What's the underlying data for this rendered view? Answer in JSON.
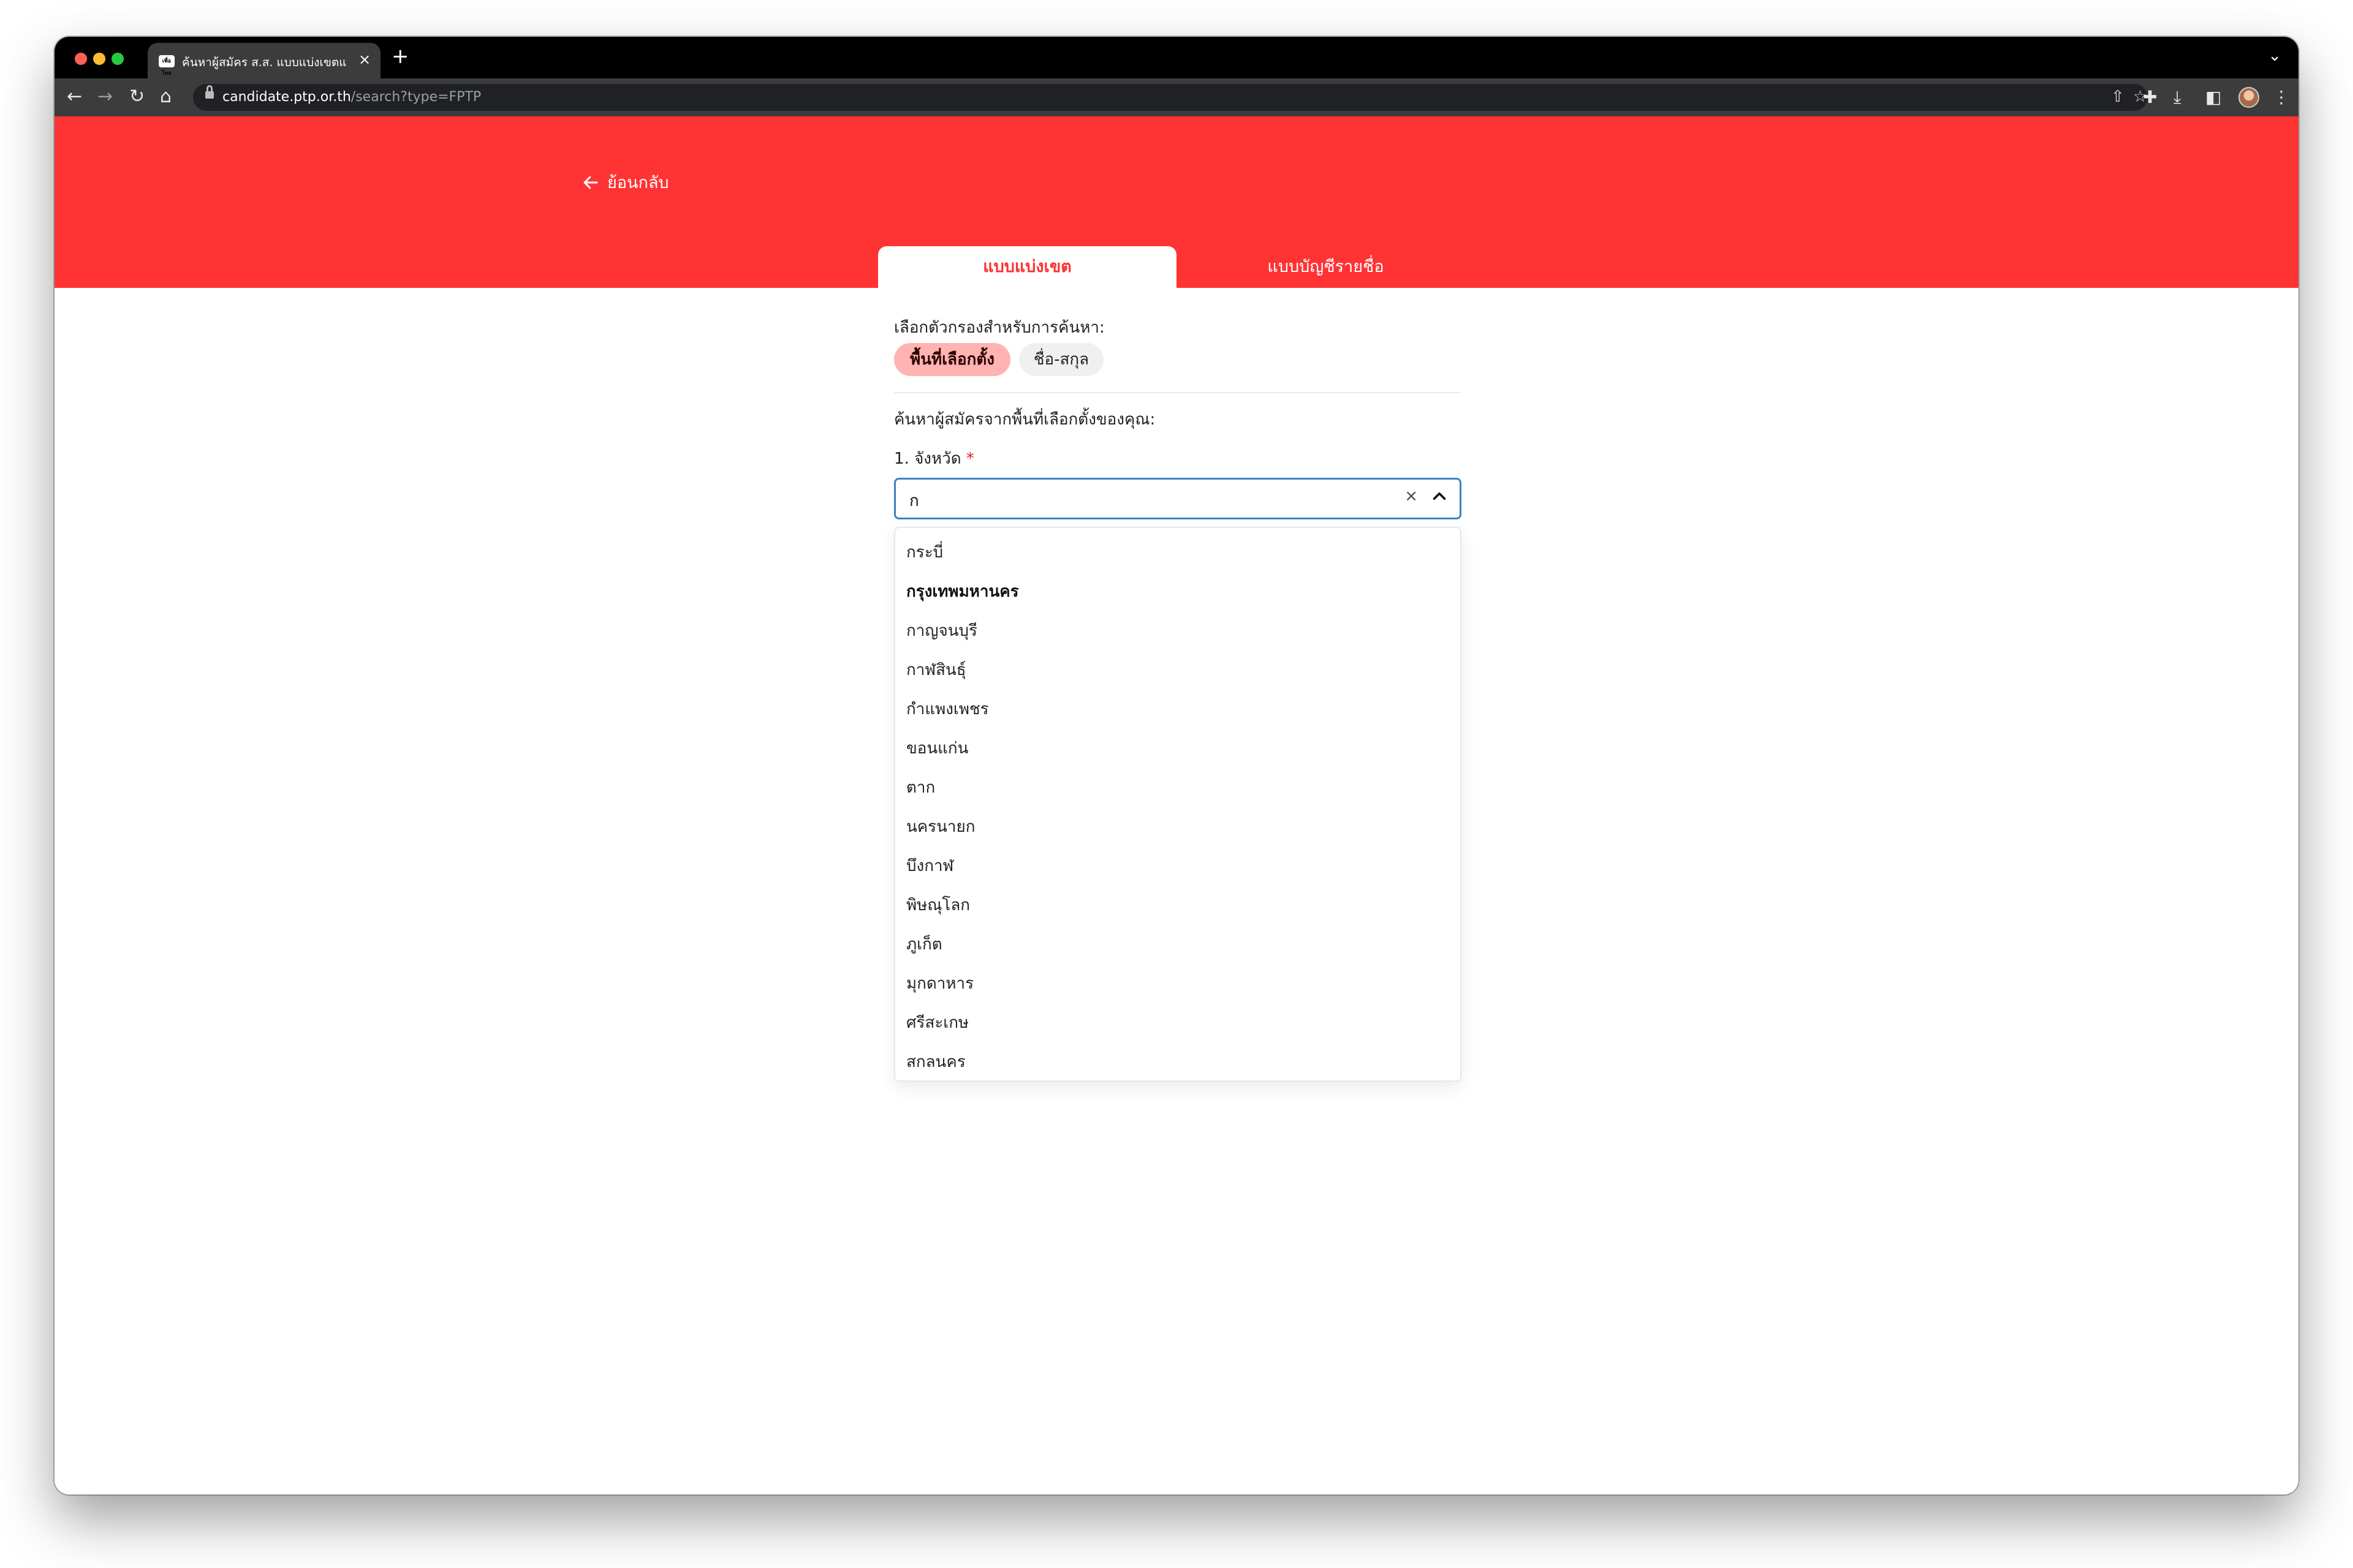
{
  "browser": {
    "tab_title": "ค้นหาผู้สมัคร ส.ส. แบบแบ่งเขตและ",
    "tab_favicon_text": "เพื่อไทย",
    "url_host": "candidate.ptp.or.th",
    "url_path": "/search?type=FPTP"
  },
  "header": {
    "back_label": "ย้อนกลับ",
    "tabs": [
      {
        "label": "แบบแบ่งเขต",
        "active": true
      },
      {
        "label": "แบบบัญชีรายชื่อ",
        "active": false
      }
    ],
    "accent_color": "#ff3333"
  },
  "filters": {
    "label": "เลือกตัวกรองสำหรับการค้นหา:",
    "chips": [
      {
        "label": "พื้นที่เลือกตั้ง",
        "active": true
      },
      {
        "label": "ชื่อ-สกุล",
        "active": false
      }
    ]
  },
  "search": {
    "heading": "ค้นหาผู้สมัครจากพื้นที่เลือกตั้งของคุณ:",
    "province_label": "1. จังหวัด",
    "required_mark": "*",
    "province_value": "ก",
    "options": [
      "กระบี่",
      "กรุงเทพมหานคร",
      "กาญจนบุรี",
      "กาฬสินธุ์",
      "กำแพงเพชร",
      "ขอนแก่น",
      "ตาก",
      "นครนายก",
      "บึงกาฬ",
      "พิษณุโลก",
      "ภูเก็ต",
      "มุกดาหาร",
      "ศรีสะเกษ",
      "สกลนคร"
    ],
    "highlighted_option": "กรุงเทพมหานคร"
  }
}
